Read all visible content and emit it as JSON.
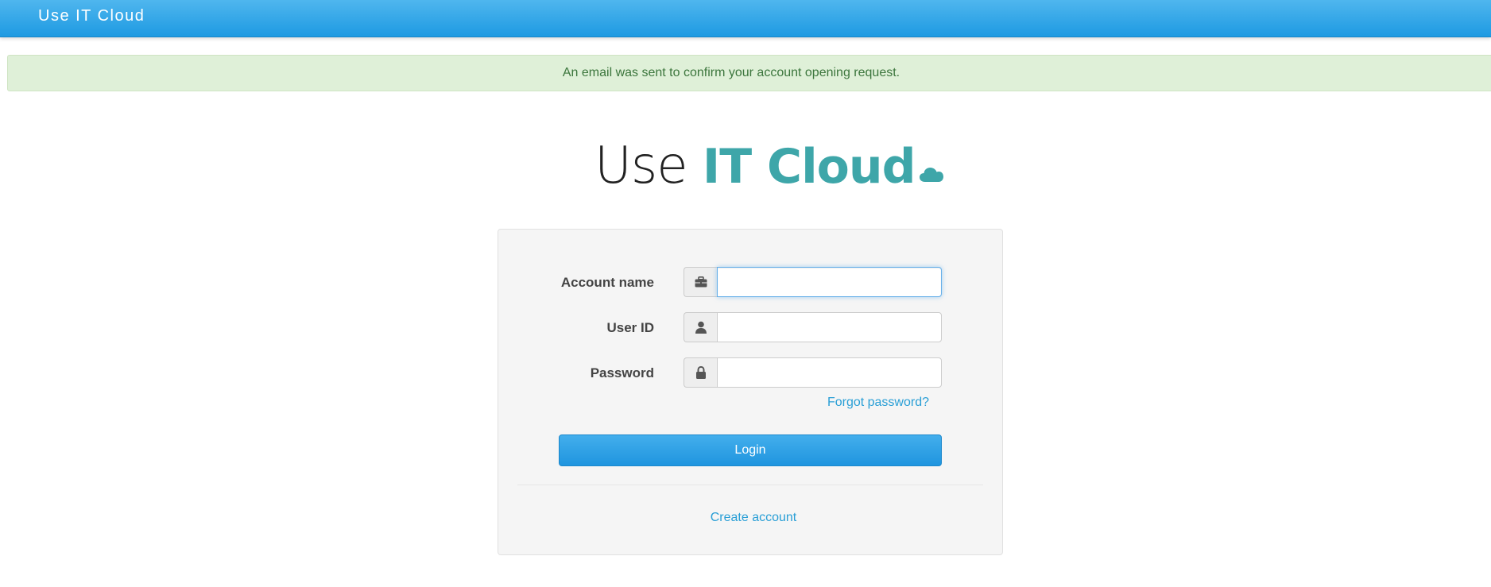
{
  "header": {
    "brand": "Use IT Cloud"
  },
  "alert": {
    "message": "An email was sent to confirm your account opening request."
  },
  "logo": {
    "text_light": "Use ",
    "text_bold": "IT Cloud",
    "icon": "cloud-icon",
    "accent_color": "#3ea6a9"
  },
  "form": {
    "fields": [
      {
        "label": "Account name",
        "icon": "briefcase-icon",
        "value": "",
        "focused": true
      },
      {
        "label": "User ID",
        "icon": "user-icon",
        "value": ""
      },
      {
        "label": "Password",
        "icon": "lock-icon",
        "value": ""
      }
    ],
    "forgot_label": "Forgot password?",
    "login_label": "Login",
    "create_label": "Create account"
  },
  "colors": {
    "header": "#1e9ae2",
    "link": "#2a9fd6",
    "alert_bg": "#dff0d8",
    "alert_text": "#3c763d"
  }
}
